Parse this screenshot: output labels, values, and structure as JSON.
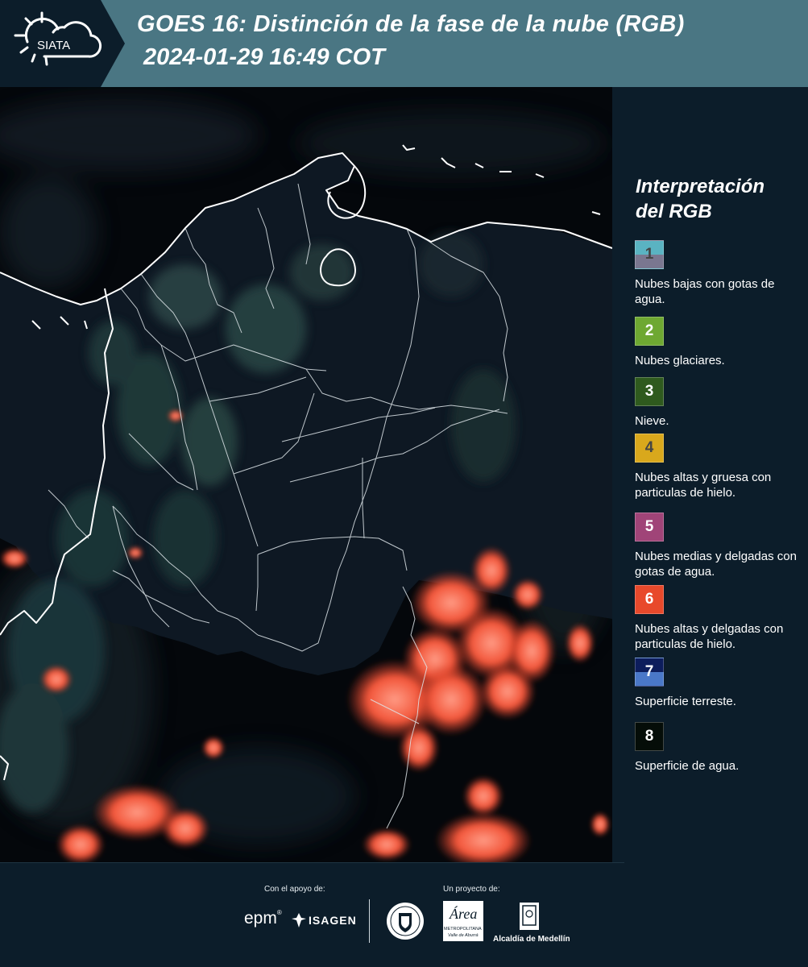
{
  "header": {
    "logo_text": "SIATA",
    "title_line1": "GOES 16: Distinción de la fase de la nube (RGB)",
    "title_line2": "2024-01-29 16:49 COT"
  },
  "legend": {
    "title": "Interpretación del RGB",
    "items": [
      {
        "number": "1",
        "top_color": "#5ab3c2",
        "bottom_color": "#7a7790",
        "number_color": "#444444",
        "label": "Nubes bajas con gotas de agua."
      },
      {
        "number": "2",
        "top_color": "#6ea832",
        "bottom_color": "#6ea832",
        "number_color": "#ffffff",
        "label": "Nubes glaciares."
      },
      {
        "number": "3",
        "top_color": "#2f5a1e",
        "bottom_color": "#2f5a1e",
        "number_color": "#ffffff",
        "label": "Nieve."
      },
      {
        "number": "4",
        "top_color": "#d9a81c",
        "bottom_color": "#d9a81c",
        "number_color": "#444444",
        "label": "Nubes altas y gruesa con particulas de hielo."
      },
      {
        "number": "5",
        "top_color": "#a04478",
        "bottom_color": "#a04478",
        "number_color": "#ffffff",
        "label": "Nubes medias y delgadas con gotas de agua."
      },
      {
        "number": "6",
        "top_color": "#e8492b",
        "bottom_color": "#e8492b",
        "number_color": "#ffffff",
        "label": "Nubes altas y delgadas con particulas de hielo."
      },
      {
        "number": "7",
        "top_color": "#0d1d5c",
        "bottom_color": "#4a78c8",
        "number_color": "#ffffff",
        "label": "Superficie terreste."
      },
      {
        "number": "8",
        "top_color": "#050d08",
        "bottom_color": "#050d08",
        "number_color": "#ffffff",
        "label": "Superficie de agua."
      }
    ]
  },
  "footer": {
    "support_label": "Con el apoyo de:",
    "project_label": "Un proyecto de:",
    "epm_text": "epm",
    "isagen_text": "ISAGEN",
    "metropolitana_text": "METROPOLITANA",
    "valle_text": "Valle de Aburrá",
    "area_text": "Área",
    "alcaldia_text": "Alcaldía de Medellín"
  }
}
